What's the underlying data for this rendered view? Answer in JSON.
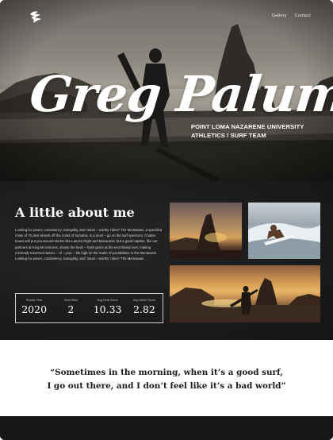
{
  "nav": {
    "logo_icon": "wave-logo-icon",
    "items": [
      {
        "label": "Gallery"
      },
      {
        "label": "Contact"
      }
    ]
  },
  "hero": {
    "name": "Greg Palumbo",
    "subtitle_line1": "POINT LOMA NAZARENE UNIVERSITY",
    "subtitle_line2": "ATHLETICS / SURF TEAM"
  },
  "about": {
    "title": "A little about me",
    "body": "Looking for power, consistency, tranquility, and ‘mack – worthy’ rides? The Mentawais, a speckled chain of 70 plus islands off the coast of Sumatra, is a must – go on the surf spectrum. Chatter boxes will put you around stories like Lances Right and Macaronis, but a good captain, like our partners at King Mi ventures, shows the hush – hush gems at the next island over, making minimally traversed waves – of – your – life high on the realm of possibilities in the Mentawais. Looking for power, consistency, tranquility, and ‘mack – worthy’ rides? The Mentawais.",
    "stats": [
      {
        "label": "Rookie Year",
        "value": "2020"
      },
      {
        "label": "Heat Wins",
        "value": "2"
      },
      {
        "label": "Avg Heat Score",
        "value": "10.33"
      },
      {
        "label": "Avg Wave Score",
        "value": "2.82"
      }
    ]
  },
  "quote": {
    "line1": "“Sometimes in the morning, when it’s a good surf,",
    "line2": "I go out there, and I don’t feel like it’s a bad world”"
  }
}
